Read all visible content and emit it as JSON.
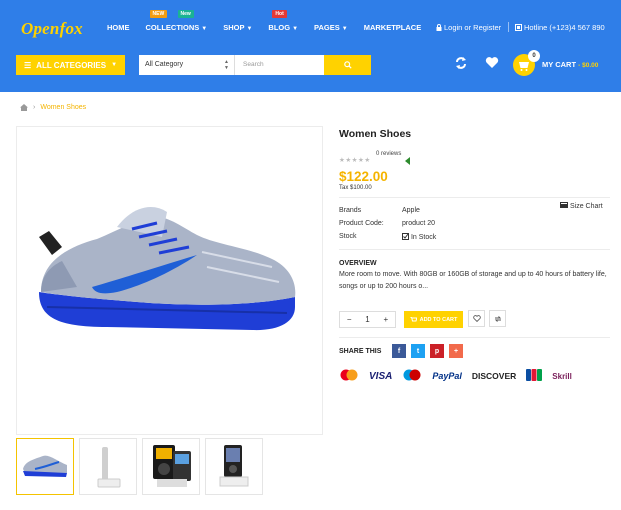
{
  "header": {
    "logo": "Openfox",
    "nav": [
      {
        "label": "HOME",
        "chevron": false,
        "badge": null
      },
      {
        "label": "COLLECTIONS",
        "chevron": true,
        "badge": [
          "NEW",
          "New"
        ]
      },
      {
        "label": "SHOP",
        "chevron": true,
        "badge": null
      },
      {
        "label": "BLOG",
        "chevron": true,
        "badge": [
          "Hot"
        ]
      },
      {
        "label": "PAGES",
        "chevron": true,
        "badge": null
      },
      {
        "label": "MARKETPLACE",
        "chevron": false,
        "badge": null
      }
    ],
    "login": "Login or Register",
    "hotline": "Hotline (+123)4 567 890",
    "all_categories": "ALL CATEGORIES",
    "search_category": "All Category",
    "search_placeholder": "Search",
    "cart_count": "0",
    "cart_label": "MY CART",
    "cart_total": "- $0.00",
    "accent_color": "#ffd200",
    "header_bg": "#2f7ee8"
  },
  "breadcrumb": {
    "home_icon": "home-icon",
    "current": "Women Shoes"
  },
  "product": {
    "title": "Women Shoes",
    "reviews": "0 reviews",
    "price": "$122.00",
    "tax": "Tax $100.00",
    "brand_label": "Brands",
    "brand_value": "Apple",
    "code_label": "Product Code:",
    "code_value": "product 20",
    "stock_label": "Stock",
    "stock_value": "In Stock",
    "size_chart": "Size Chart",
    "overview_heading": "OVERVIEW",
    "overview_text": "More room to move. With 80GB or 160GB of storage and up to 40 hours of battery life, songs or up to 200 hours o...",
    "quantity": "1",
    "add_to_cart": "ADD TO CART",
    "share_label": "SHARE THIS"
  },
  "payments": [
    "MasterCard",
    "VISA",
    "Maestro",
    "PayPal",
    "DISCOVER",
    "JCB",
    "Skrill"
  ]
}
